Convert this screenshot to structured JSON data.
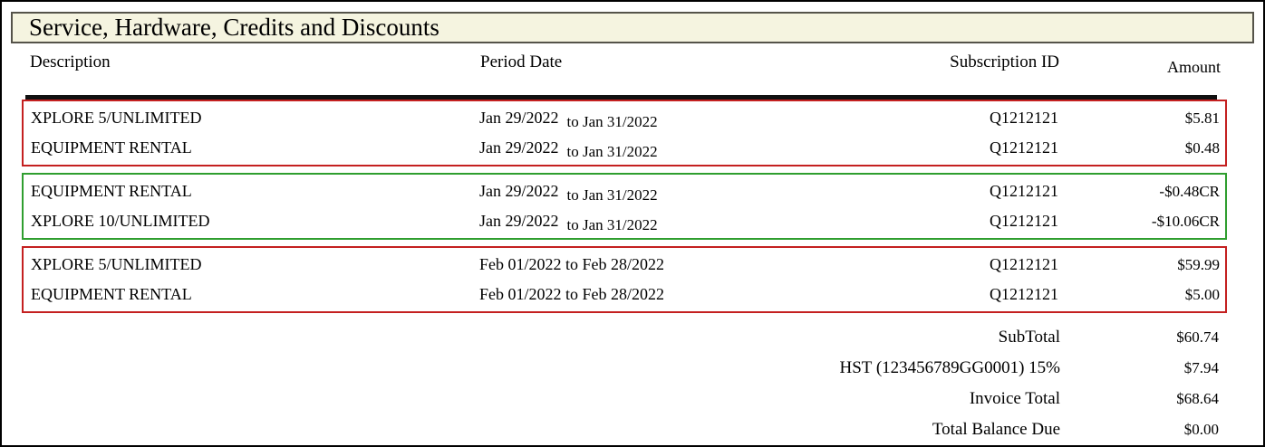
{
  "title": "Service, Hardware, Credits and Discounts",
  "columns": {
    "description": "Description",
    "period_date": "Period Date",
    "subscription_id": "Subscription ID",
    "amount": "Amount"
  },
  "groups": [
    {
      "type": "charges",
      "border_color": "#c42020",
      "border_style": "border-color:#c42020",
      "rows": [
        {
          "description": "XPLORE 5/UNLIMITED",
          "period_main": "Jan 29/2022",
          "period_shift": "to Jan 31/2022",
          "subscription_id": "Q1212121",
          "amount": "$5.81"
        },
        {
          "description": "EQUIPMENT RENTAL",
          "period_main": "Jan 29/2022",
          "period_shift": "to Jan 31/2022",
          "subscription_id": "Q1212121",
          "amount": "$0.48"
        }
      ]
    },
    {
      "type": "credits",
      "border_color": "#2f9e2f",
      "border_style": "border-color:#2f9e2f",
      "rows": [
        {
          "description": "EQUIPMENT RENTAL",
          "period_main": "Jan 29/2022",
          "period_shift": "to Jan 31/2022",
          "subscription_id": "Q1212121",
          "amount": "-$0.48CR"
        },
        {
          "description": "XPLORE 10/UNLIMITED",
          "period_main": "Jan 29/2022",
          "period_shift": "to Jan 31/2022",
          "subscription_id": "Q1212121",
          "amount": "-$10.06CR"
        }
      ]
    },
    {
      "type": "charges",
      "border_color": "#c42020",
      "border_style": "border-color:#c42020",
      "rows": [
        {
          "description": "XPLORE 5/UNLIMITED",
          "period_main": "Feb 01/2022 to Feb 28/2022",
          "period_shift": "",
          "subscription_id": "Q1212121",
          "amount": "$59.99"
        },
        {
          "description": "EQUIPMENT RENTAL",
          "period_main": "Feb 01/2022 to Feb 28/2022",
          "period_shift": "",
          "subscription_id": "Q1212121",
          "amount": "$5.00"
        }
      ]
    }
  ],
  "summary": {
    "rows": [
      {
        "label": "SubTotal",
        "amount": "$60.74"
      },
      {
        "label": "HST (123456789GG0001) 15%",
        "amount": "$7.94"
      },
      {
        "label": "Invoice Total",
        "amount": "$68.64"
      },
      {
        "label": "Total Balance Due",
        "amount": "$0.00"
      }
    ]
  },
  "colors": {
    "charge_border": "#c42020",
    "credit_border": "#2f9e2f",
    "title_bar_bg": "#f5f4e0",
    "title_bar_border": "#55534a",
    "divider": "#111111",
    "page_border": "#000000"
  }
}
